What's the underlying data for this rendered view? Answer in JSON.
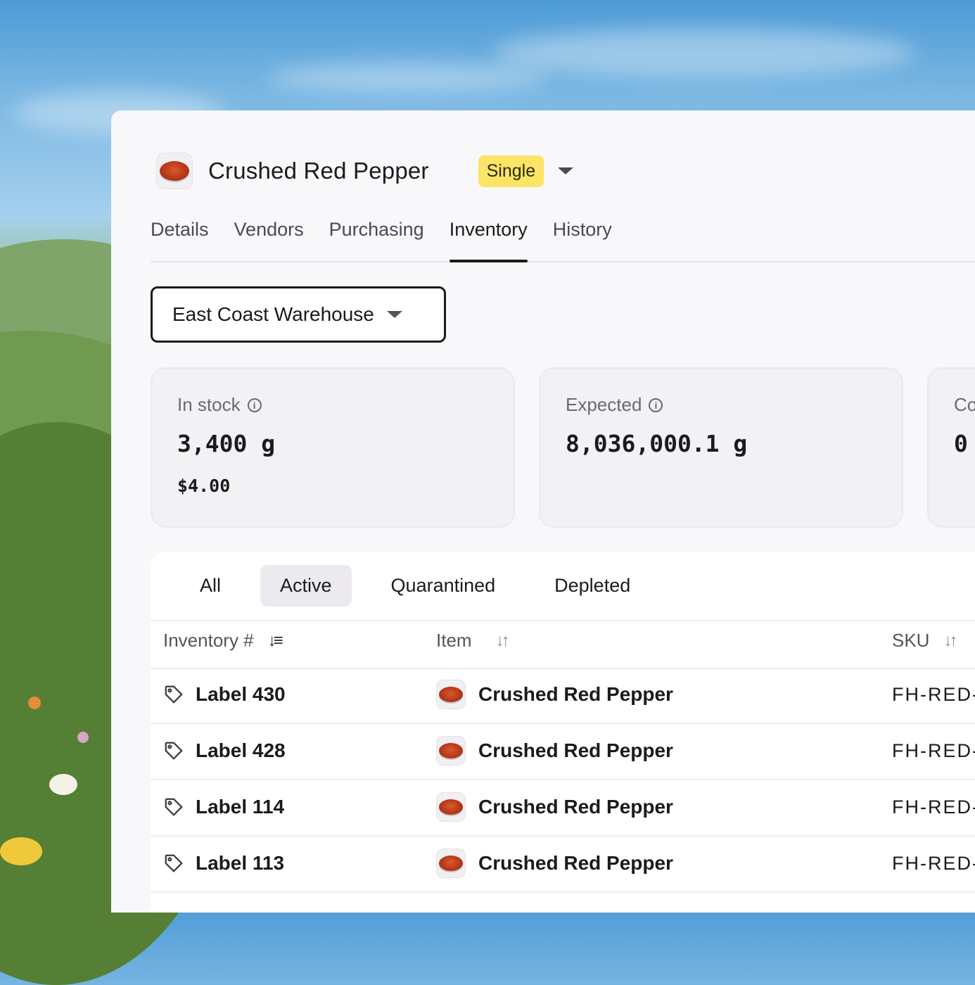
{
  "item": {
    "name": "Crushed Red Pepper",
    "badge": "Single"
  },
  "tabs": [
    {
      "label": "Details"
    },
    {
      "label": "Vendors"
    },
    {
      "label": "Purchasing"
    },
    {
      "label": "Inventory"
    },
    {
      "label": "History"
    }
  ],
  "active_tab": "Inventory",
  "location_select": {
    "value": "East Coast Warehouse"
  },
  "cards": [
    {
      "label": "In stock",
      "value": "3,400 g",
      "sub": "$4.00"
    },
    {
      "label": "Expected",
      "value": "8,036,000.1 g",
      "sub": ""
    },
    {
      "label": "Co",
      "value": "0",
      "sub": ""
    }
  ],
  "filters": [
    {
      "label": "All"
    },
    {
      "label": "Active"
    },
    {
      "label": "Quarantined"
    },
    {
      "label": "Depleted"
    }
  ],
  "active_filter": "Active",
  "table": {
    "columns": [
      {
        "label": "Inventory #",
        "sort": "desc"
      },
      {
        "label": "Item",
        "sort": "none"
      },
      {
        "label": "SKU",
        "sort": "none"
      }
    ],
    "rows": [
      {
        "inventory": "Label 430",
        "item": "Crushed Red Pepper",
        "sku": "FH-RED-"
      },
      {
        "inventory": "Label 428",
        "item": "Crushed Red Pepper",
        "sku": "FH-RED-"
      },
      {
        "inventory": "Label 114",
        "item": "Crushed Red Pepper",
        "sku": "FH-RED-"
      },
      {
        "inventory": "Label 113",
        "item": "Crushed Red Pepper",
        "sku": "FH-RED-"
      }
    ]
  },
  "colors": {
    "badge": "#fbe466",
    "panel": "#f8f7f9",
    "accent": "#1b1b1d"
  }
}
